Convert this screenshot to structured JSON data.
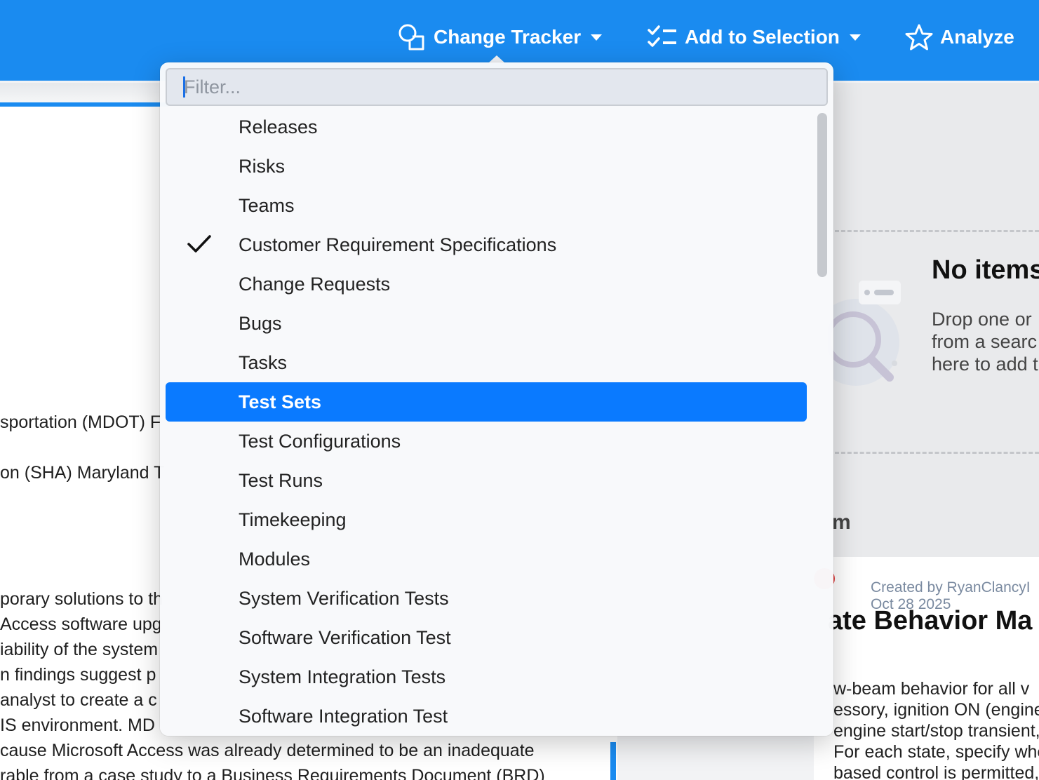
{
  "toolbar": {
    "change_tracker": "Change Tracker",
    "add_to_selection": "Add to Selection",
    "analyze": "Analyze"
  },
  "dropdown": {
    "filter_placeholder": "Filter...",
    "items": [
      {
        "label": "Releases",
        "checked": false,
        "highlighted": false
      },
      {
        "label": "Risks",
        "checked": false,
        "highlighted": false
      },
      {
        "label": "Teams",
        "checked": false,
        "highlighted": false
      },
      {
        "label": "Customer Requirement Specifications",
        "checked": true,
        "highlighted": false
      },
      {
        "label": "Change Requests",
        "checked": false,
        "highlighted": false
      },
      {
        "label": "Bugs",
        "checked": false,
        "highlighted": false
      },
      {
        "label": "Tasks",
        "checked": false,
        "highlighted": false
      },
      {
        "label": "Test Sets",
        "checked": false,
        "highlighted": true
      },
      {
        "label": "Test Configurations",
        "checked": false,
        "highlighted": false
      },
      {
        "label": "Test Runs",
        "checked": false,
        "highlighted": false
      },
      {
        "label": "Timekeeping",
        "checked": false,
        "highlighted": false
      },
      {
        "label": "Modules",
        "checked": false,
        "highlighted": false
      },
      {
        "label": "System Verification Tests",
        "checked": false,
        "highlighted": false
      },
      {
        "label": "Software Verification Test",
        "checked": false,
        "highlighted": false
      },
      {
        "label": "System Integration Tests",
        "checked": false,
        "highlighted": false
      },
      {
        "label": "Software Integration Test",
        "checked": false,
        "highlighted": false
      }
    ]
  },
  "left_doc": {
    "lines": [
      "sportation (MDOT) F",
      "on (SHA) Maryland T",
      "porary solutions to th",
      "Access software upg",
      "iability of the system",
      "n findings suggest p",
      "analyst to create a c",
      "IS environment. MD",
      "cause Microsoft Access was already determined to be an inadequate",
      "rable from a case study to a Business Requirements Document (BRD)"
    ]
  },
  "right_panel": {
    "empty_title": "No items",
    "empty_text": [
      "Drop one or",
      "from a searc",
      "here to add t"
    ],
    "partial_heading": "m",
    "card": {
      "created_by": "Created by RyanClancyI",
      "date": "Oct 28 2025",
      "title": "ate Behavior Ma",
      "body": [
        "w-beam behavior for all v",
        "essory, ignition ON (engine",
        "engine start/stop transient, parking, and sle",
        "For each state, specify whether automatic a",
        "based control is permitted, whether manual"
      ]
    }
  }
}
